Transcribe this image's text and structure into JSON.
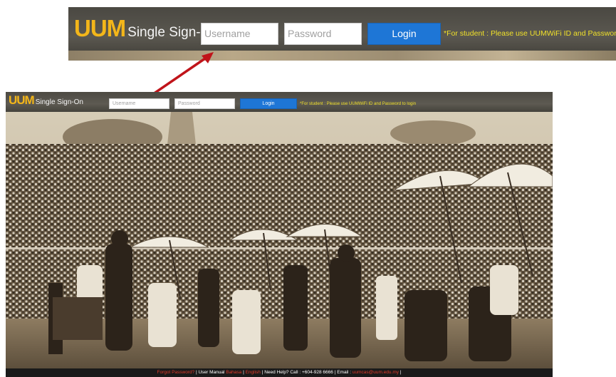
{
  "zoom": {
    "logo_uum": "UUM",
    "logo_sso": "Single Sign-On",
    "username_placeholder": "Username",
    "password_placeholder": "Password",
    "login_label": "Login",
    "notice": "*For student : Please use UUMWiFi ID and Password to login"
  },
  "page": {
    "logo_uum": "UUM",
    "logo_sso": "Single Sign-On",
    "username_placeholder": "Username",
    "password_placeholder": "Password",
    "login_label": "Login",
    "notice": "*For student : Please use UUMWiFi ID and Password to login",
    "footer": {
      "forgot": "Forgot Password?",
      "sep1": " | ",
      "manual": "User Manual",
      "sep2": " ",
      "lang_bm": "Bahasa",
      "sep3": " | ",
      "lang_en": "English",
      "help": " | Need Help? Call : +604-928 6666 | Email : ",
      "email": "uumcas@uum.edu.my",
      "end": " |"
    }
  },
  "colors": {
    "accent": "#f3b61a",
    "button": "#1e76d6",
    "notice": "#f0e02a",
    "arrow": "#c0141a"
  }
}
